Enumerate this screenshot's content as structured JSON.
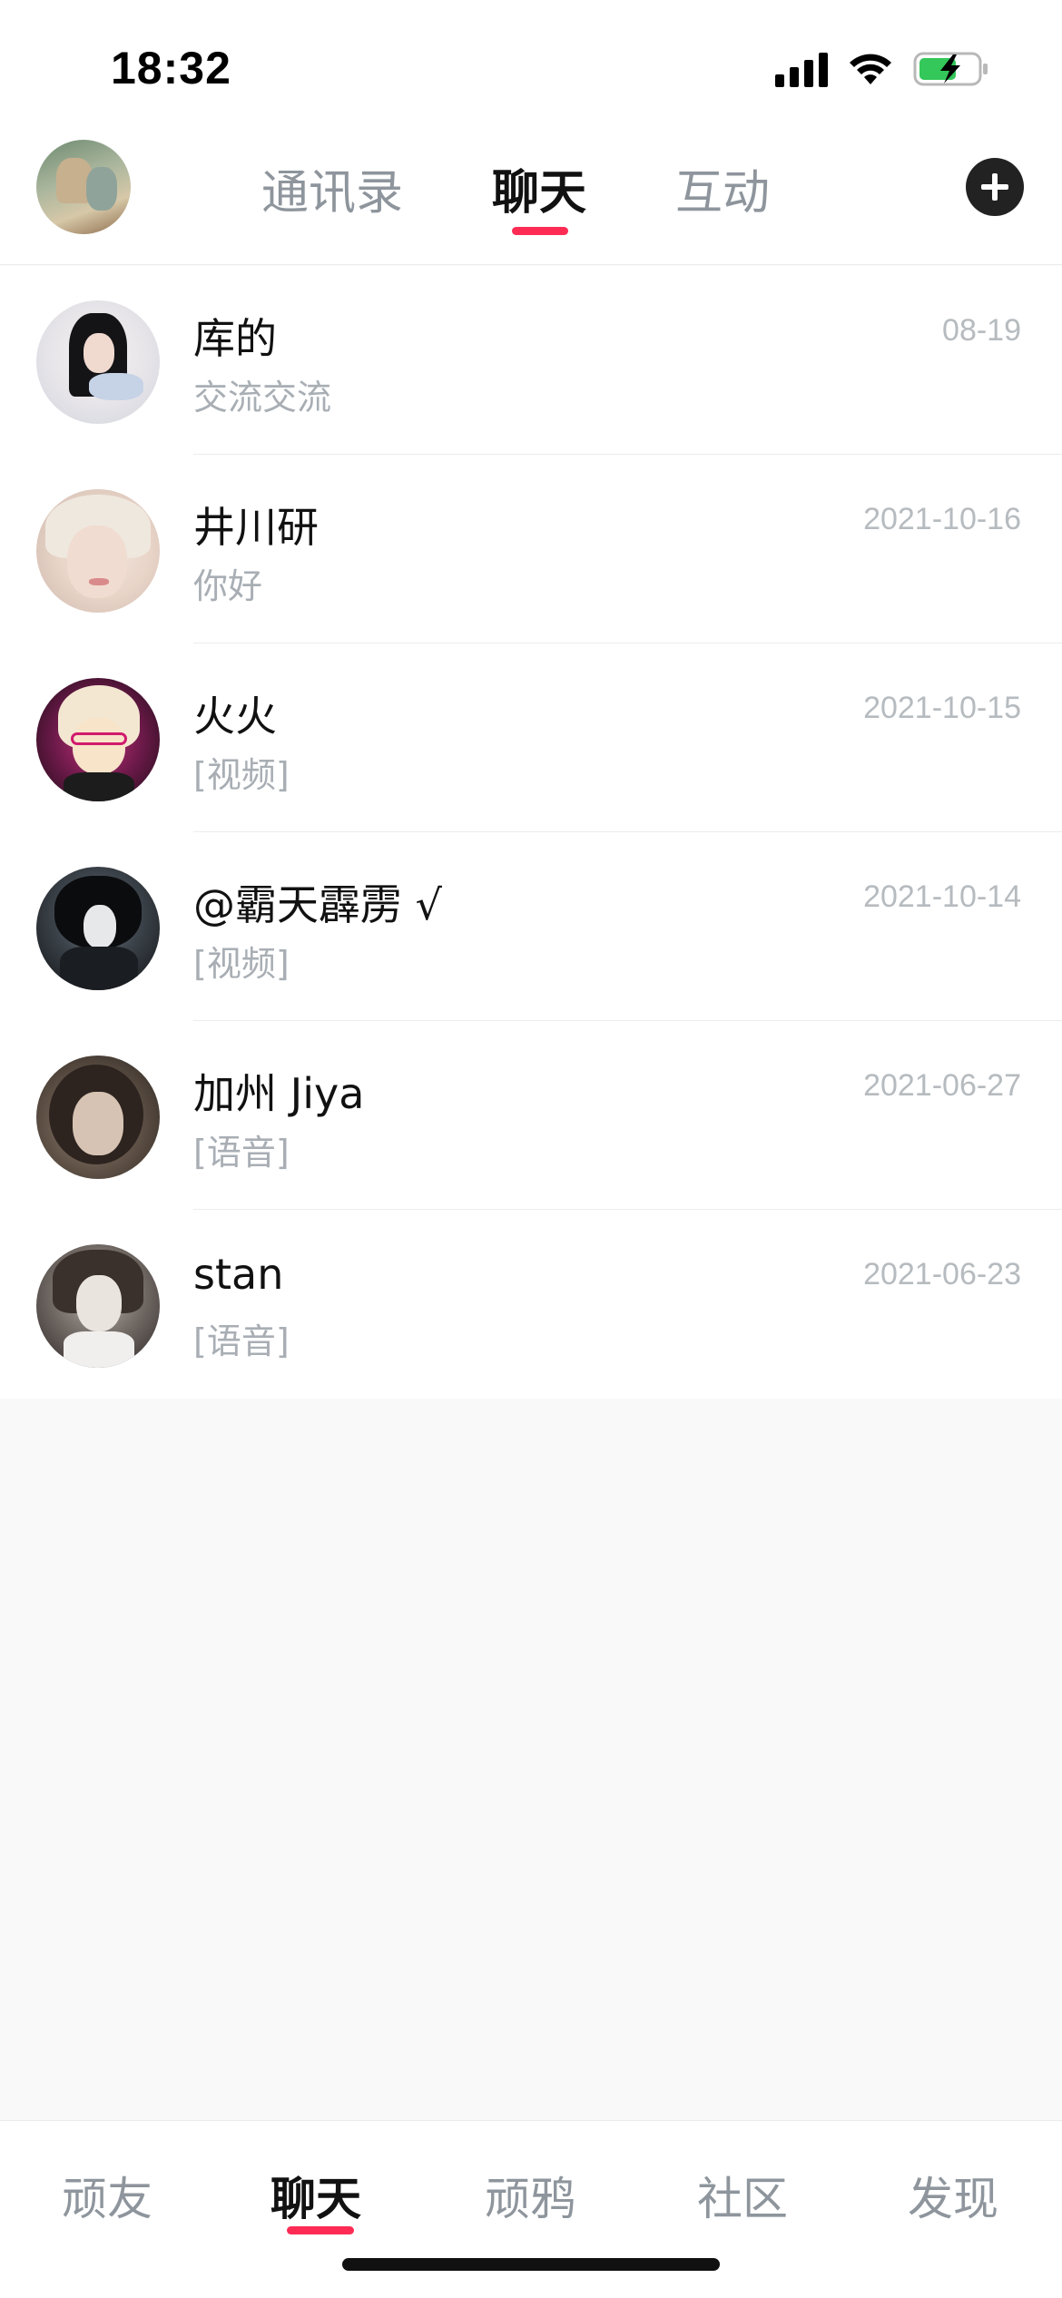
{
  "status_bar": {
    "time": "18:32"
  },
  "top_nav": {
    "tabs": [
      {
        "label": "通讯录",
        "active": false
      },
      {
        "label": "聊天",
        "active": true
      },
      {
        "label": "互动",
        "active": false
      }
    ],
    "add_icon": "plus-icon",
    "accent_color": "#fe2c55"
  },
  "chats": [
    {
      "name": "库的",
      "preview": "交流交流",
      "date": "08-19"
    },
    {
      "name": "井川研",
      "preview": "你好",
      "date": "2021-10-16"
    },
    {
      "name": "火火",
      "preview": "[视频]",
      "date": "2021-10-15"
    },
    {
      "name": "@霸天霹雳 √",
      "preview": "[视频]",
      "date": "2021-10-14"
    },
    {
      "name": "加州 Jiya",
      "preview": "[语音]",
      "date": "2021-06-27"
    },
    {
      "name": "stan",
      "preview": "[语音]",
      "date": "2021-06-23"
    }
  ],
  "bottom_nav": {
    "tabs": [
      {
        "label": "顽友",
        "active": false
      },
      {
        "label": "聊天",
        "active": true
      },
      {
        "label": "顽鸦",
        "active": false
      },
      {
        "label": "社区",
        "active": false
      },
      {
        "label": "发现",
        "active": false
      }
    ]
  }
}
